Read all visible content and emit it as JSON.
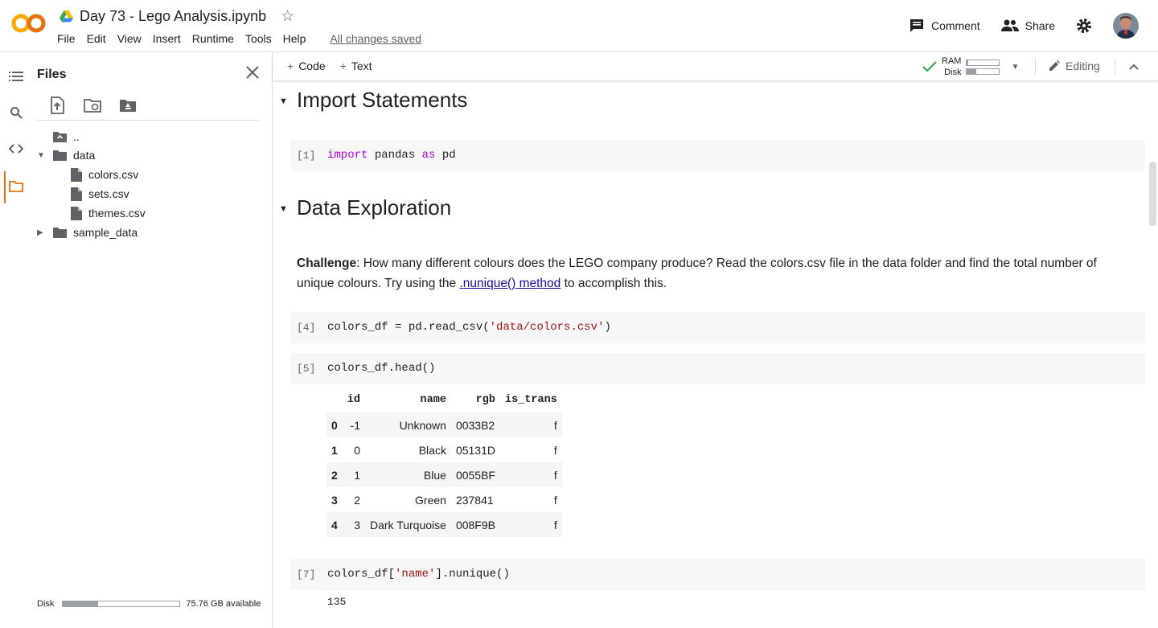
{
  "header": {
    "title": "Day 73 - Lego Analysis.ipynb",
    "menu": [
      "File",
      "Edit",
      "View",
      "Insert",
      "Runtime",
      "Tools",
      "Help"
    ],
    "saved_status": "All changes saved",
    "comment_label": "Comment",
    "share_label": "Share"
  },
  "files_panel": {
    "title": "Files",
    "parent": "..",
    "folder_data": "data",
    "files": [
      "colors.csv",
      "sets.csv",
      "themes.csv"
    ],
    "folder_sample": "sample_data",
    "disk_label": "Disk",
    "disk_available": "75.76 GB available",
    "disk_used_fraction": 0.3
  },
  "toolbar": {
    "code_label": "Code",
    "text_label": "Text",
    "ram_label": "RAM",
    "disk_label": "Disk",
    "ram_fraction": 0.03,
    "disk_fraction": 0.3,
    "editing_label": "Editing"
  },
  "notebook": {
    "section1": "Import Statements",
    "cell1_prompt": "[1]",
    "section2": "Data Exploration",
    "challenge_bold": "Challenge",
    "challenge_text1": ": How many different colours does the LEGO company produce? Read the colors.csv file in the data folder and find the total number of unique colours. Try using the ",
    "challenge_link": ".nunique() method",
    "challenge_text2": " to accomplish this.",
    "cell4_prompt": "[4]",
    "cell5_prompt": "[5]",
    "table": {
      "columns": [
        "id",
        "name",
        "rgb",
        "is_trans"
      ],
      "rows": [
        [
          "0",
          "-1",
          "Unknown",
          "0033B2",
          "f"
        ],
        [
          "1",
          "0",
          "Black",
          "05131D",
          "f"
        ],
        [
          "2",
          "1",
          "Blue",
          "0055BF",
          "f"
        ],
        [
          "3",
          "2",
          "Green",
          "237841",
          "f"
        ],
        [
          "4",
          "3",
          "Dark Turquoise",
          "008F9B",
          "f"
        ]
      ]
    },
    "cell7_prompt": "[7]",
    "cell7_output": "135"
  }
}
